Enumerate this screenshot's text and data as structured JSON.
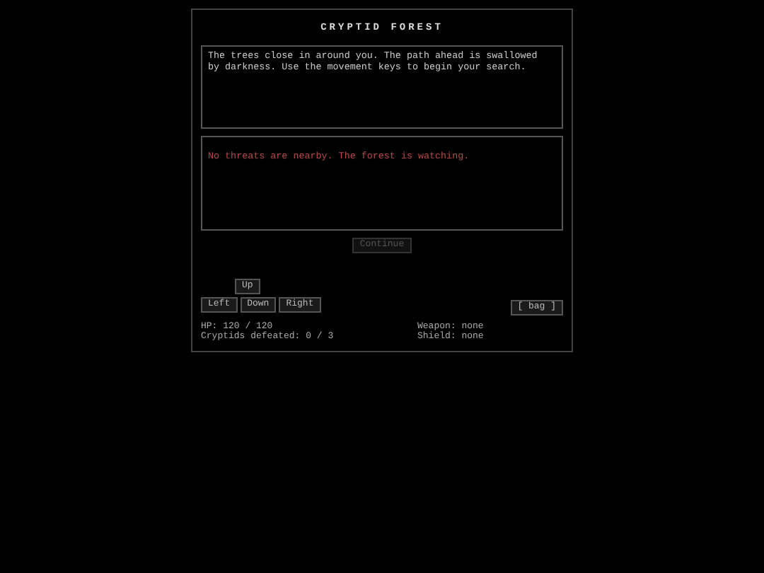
{
  "title": "CRYPTID FOREST",
  "story": "The trees close in around you. The path ahead is swallowed by darkness. Use the movement keys to begin your search.",
  "threat": "No threats are nearby. The forest is watching.",
  "continue_button": {
    "label": "Continue",
    "disabled": true
  },
  "movement": [
    {
      "kind": "up",
      "label": "Up"
    },
    {
      "kind": "left",
      "label": "Left"
    },
    {
      "kind": "down",
      "label": "Down"
    },
    {
      "kind": "right",
      "label": "Right"
    }
  ],
  "bag_button": "[ bag ]",
  "stats": {
    "hp": "HP: 120 / 120",
    "defeated": "Cryptids defeated: 0 / 3",
    "weapon": "Weapon: none",
    "shield": "Shield: none"
  }
}
